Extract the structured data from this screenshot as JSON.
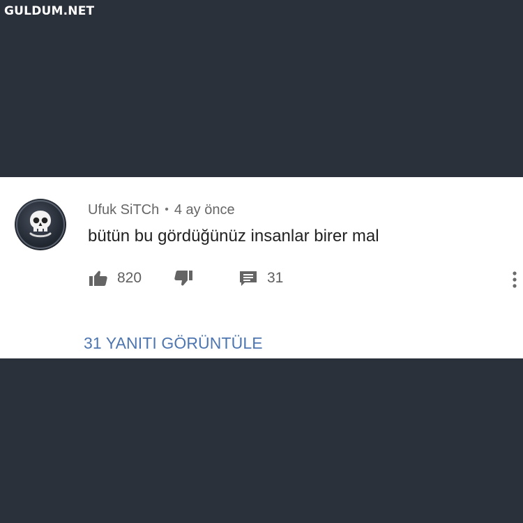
{
  "watermark": {
    "text": "GULDUM.NET"
  },
  "comment": {
    "author": "Ufuk SiTCh",
    "separator": "•",
    "time": "4 ay önce",
    "text": "bütün bu gördüğünüz insanlar birer mal",
    "avatar_icon": "skull-icon",
    "like_count": "820",
    "reply_count": "31",
    "view_replies_label": "31 YANITI GÖRÜNTÜLE"
  },
  "colors": {
    "background": "#2b313b",
    "card": "#ffffff",
    "link": "#4d76b0",
    "icon": "#646464"
  },
  "icons": {
    "like": "thumb-up-icon",
    "dislike": "thumb-down-icon",
    "reply": "comment-icon",
    "menu": "more-vertical-icon"
  }
}
